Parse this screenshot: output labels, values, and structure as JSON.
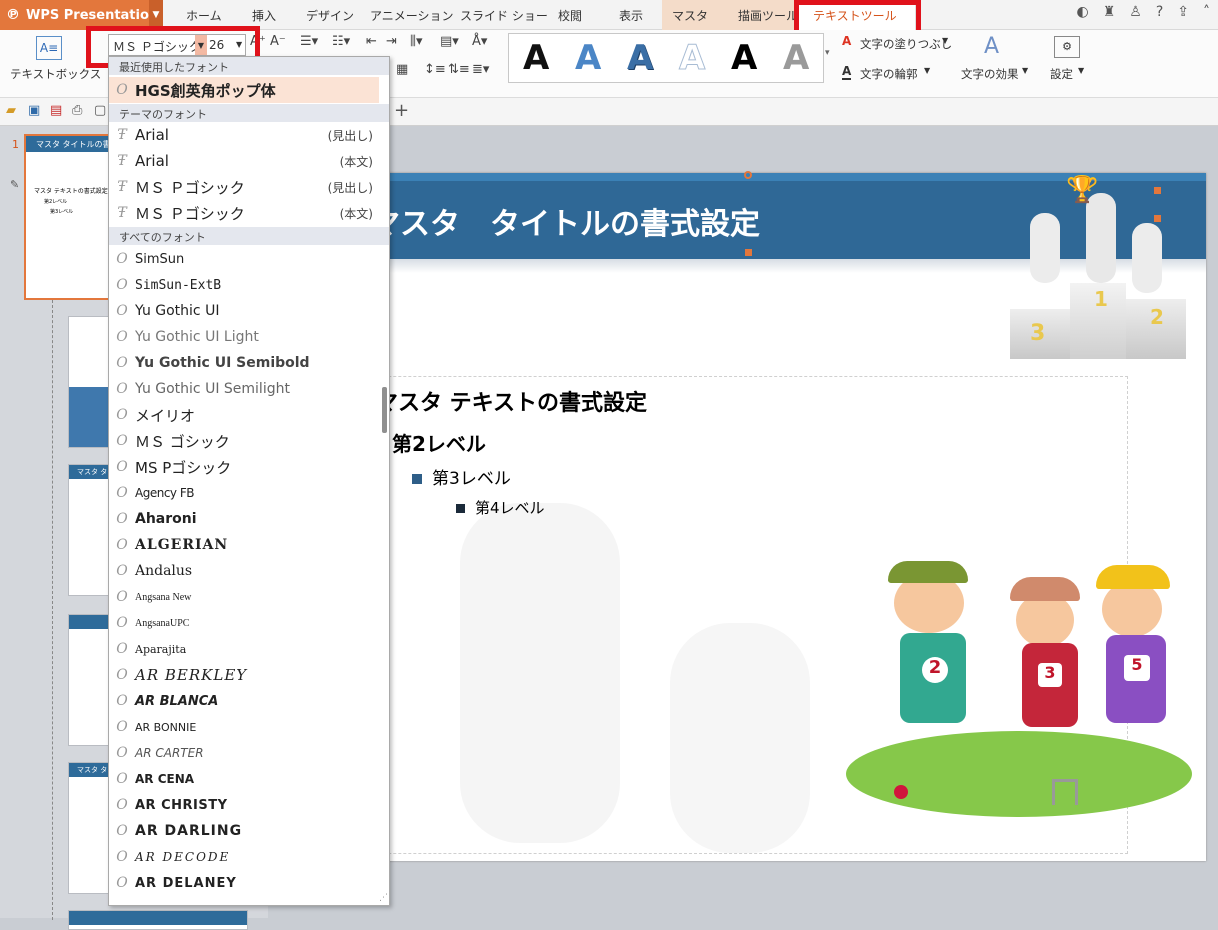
{
  "app": {
    "name": "WPS Presentation"
  },
  "tabs": [
    "ホーム",
    "挿入",
    "デザイン",
    "アニメーション",
    "スライド ショー",
    "校閲",
    "表示",
    "マスタ",
    "描画ツール",
    "テキストツール"
  ],
  "ribbon": {
    "textbox_label": "テキストボックス",
    "font_name": "ＭＳ Ｐゴシック (",
    "font_size": "26",
    "fill_label": "文字の塗りつぶし",
    "outline_label": "文字の輪郭",
    "effect_label": "文字の効果",
    "settings_label": "設定"
  },
  "font_dropdown": {
    "recent_header": "最近使用したフォント",
    "recent": [
      {
        "name": "HGS創英角ポップ体"
      }
    ],
    "theme_header": "テーマのフォント",
    "theme": [
      {
        "name": "Arial",
        "tag": "(見出し)"
      },
      {
        "name": "Arial",
        "tag": "(本文)"
      },
      {
        "name": "ＭＳ Ｐゴシック",
        "tag": "(見出し)"
      },
      {
        "name": "ＭＳ Ｐゴシック",
        "tag": "(本文)"
      }
    ],
    "all_header": "すべてのフォント",
    "all": [
      "SimSun",
      "SimSun-ExtB",
      "Yu Gothic UI",
      "Yu Gothic UI Light",
      "Yu Gothic UI Semibold",
      "Yu Gothic UI Semilight",
      "メイリオ",
      "ＭＳ ゴシック",
      "MS Pゴシック",
      "Agency FB",
      "Aharoni",
      "ALGERIAN",
      "Andalus",
      "Angsana New",
      "AngsanaUPC",
      "Aparajita",
      "AR BERKLEY",
      "AR BLANCA",
      "AR BONNIE",
      "AR CARTER",
      "AR CENA",
      "AR CHRISTY",
      "AR DARLING",
      "AR DECODE",
      "AR DELANEY"
    ]
  },
  "slide": {
    "title": "マスタ　タイトルの書式設定",
    "level1": "マスタ テキストの書式設定",
    "level2": "第2レベル",
    "level3": "第3レベル",
    "level4": "第4レベル",
    "podium": [
      "1",
      "2",
      "3"
    ],
    "bibs": [
      "2",
      "3",
      "5"
    ]
  },
  "thumbnails": {
    "current_number": "1",
    "first_title": "マスタ タイトルの書式設定",
    "first_body": "マスタ テキストの書式設定",
    "first_l2": "第2レベル",
    "first_l3": "第3レベル",
    "second_title": "マスタ タイ",
    "third_title": "マスタ タイ"
  },
  "colors": {
    "accent": "#e3773c",
    "highlight": "#e0121b",
    "title_band": "#2f6896"
  }
}
